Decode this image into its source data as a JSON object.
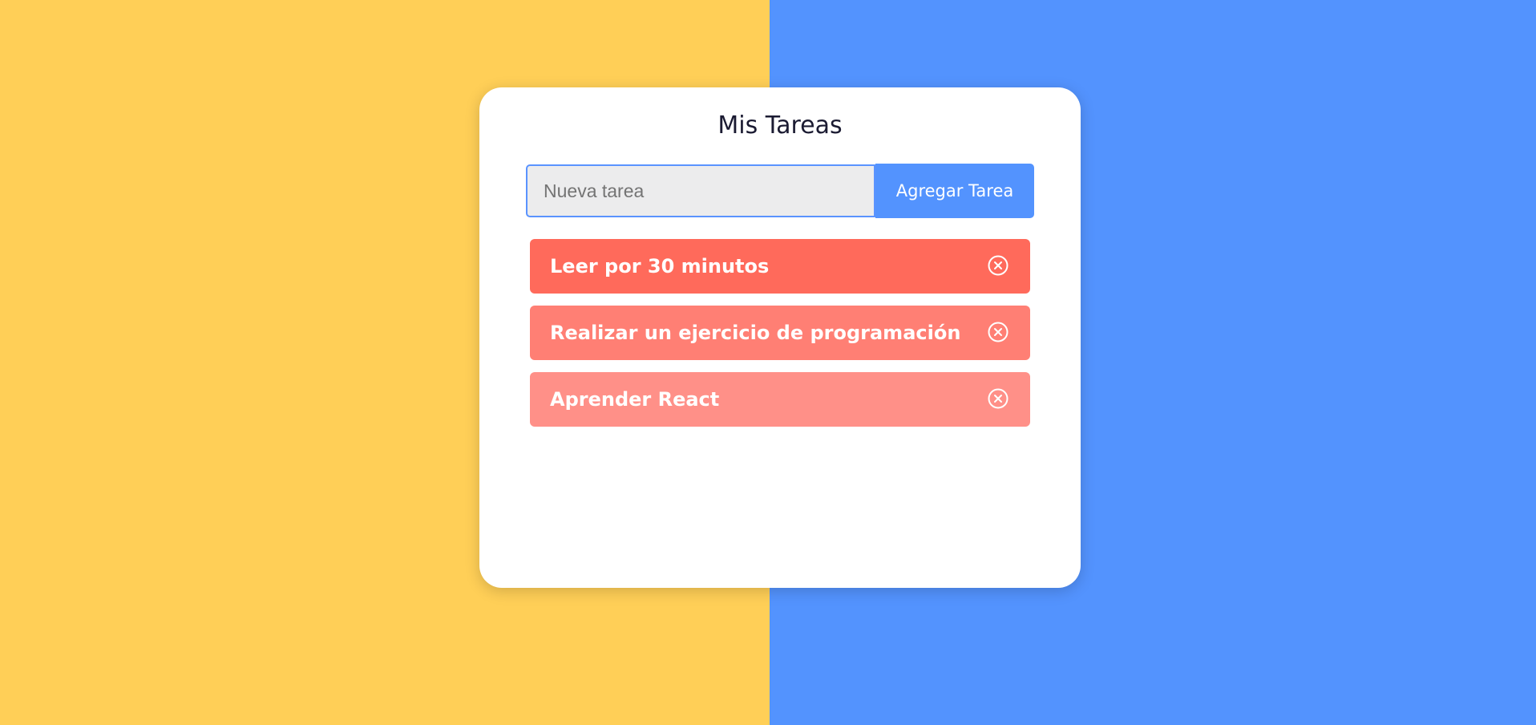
{
  "colors": {
    "background_left": "#ffcf57",
    "background_right": "#5393fe",
    "card": "#ffffff",
    "button": "#5393fe",
    "task_colors": [
      "#ff6a5b",
      "#ff7f74",
      "#ff9088"
    ]
  },
  "app": {
    "title": "Mis Tareas"
  },
  "form": {
    "input_placeholder": "Nueva tarea",
    "input_value": "",
    "add_button_label": "Agregar Tarea"
  },
  "tasks": [
    {
      "text": "Leer por 30 minutos",
      "delete_icon": "circle-x-icon"
    },
    {
      "text": "Realizar un ejercicio de programación",
      "delete_icon": "circle-x-icon"
    },
    {
      "text": "Aprender React",
      "delete_icon": "circle-x-icon"
    }
  ]
}
